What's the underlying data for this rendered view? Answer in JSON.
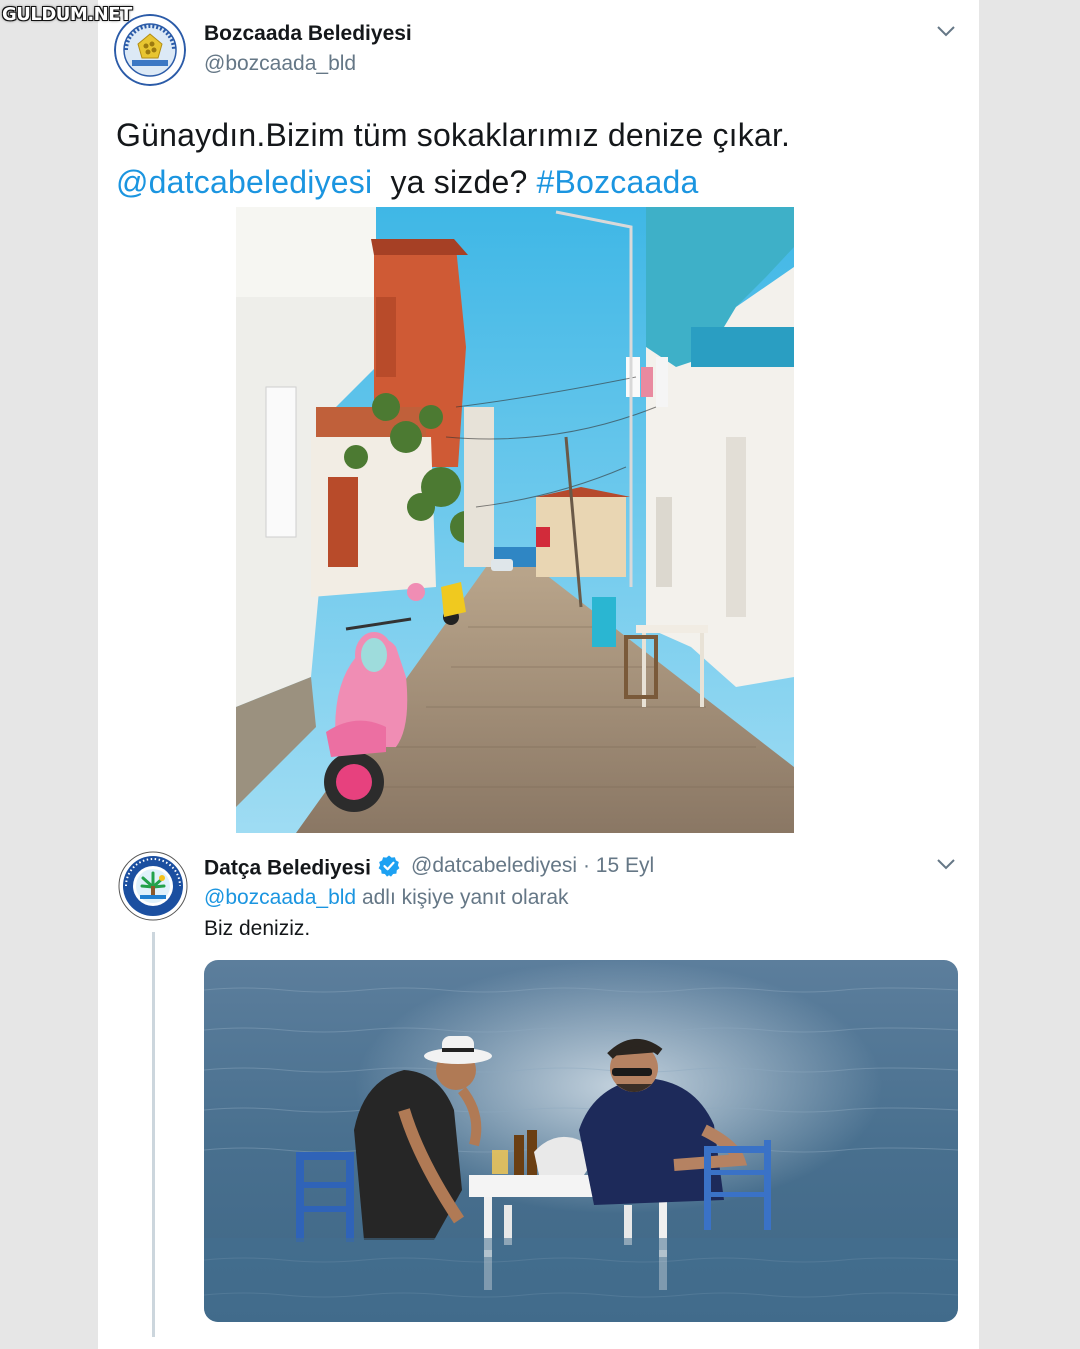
{
  "watermark": "GULDUM.NET",
  "tweet": {
    "author_name": "Bozcaada Belediyesi",
    "author_handle": "@bozcaada_bld",
    "avatar_text": "BOZCAADA BELEDİYESİ",
    "avatar_year": "1923",
    "text_line1": "Günaydın.Bizim tüm sokaklarımız denize çıkar.",
    "mention": "@datcabelediyesi",
    "text_mid": "  ya sizde? ",
    "hashtag": "#Bozcaada"
  },
  "reply": {
    "author_name": "Datça Belediyesi",
    "author_handle": "@datcabelediyesi",
    "separator": "·",
    "date": "15 Eyl",
    "reply_mention": "@bozcaada_bld",
    "reply_suffix": " adlı kişiye yanıt olarak",
    "text": "Biz deniziz."
  },
  "colors": {
    "link": "#1b95e0",
    "verified": "#1da1f2",
    "secondary_text": "#657786"
  },
  "icons": {
    "menu": "chevron-down-icon",
    "verified": "verified-badge-icon"
  }
}
